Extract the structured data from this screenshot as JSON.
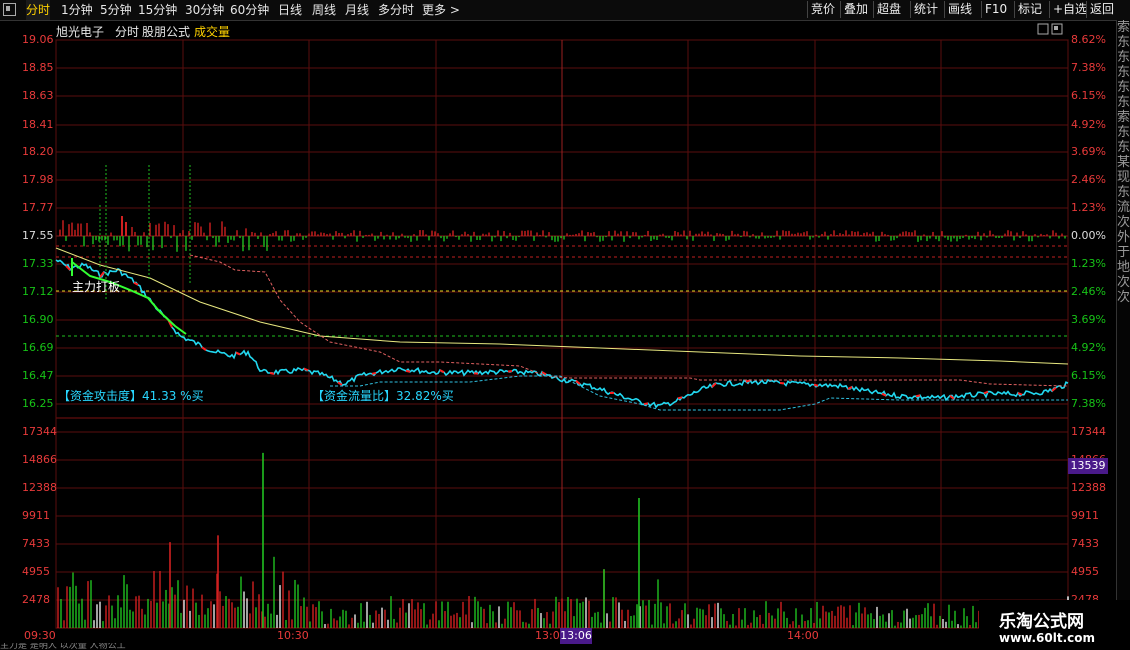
{
  "toolbar": {
    "tabs": [
      "分时",
      "1分钟",
      "5分钟",
      "15分钟",
      "30分钟",
      "60分钟",
      "日线",
      "周线",
      "月线",
      "多分时",
      "更多 >"
    ],
    "active": "分时",
    "right_buttons": [
      "竞价",
      "叠加",
      "超盘",
      "统计",
      "画线",
      "F10",
      "标记",
      "+自选",
      "返回"
    ]
  },
  "header": {
    "stock_name": "旭光电子",
    "mode": "分时",
    "formula": "股朋公式",
    "indicator": "成交量"
  },
  "annotations": {
    "main_force": "主力打板",
    "attack_label": "【资金攻击度】41.33 %买",
    "flow_label": "【资金流量比】32.82%买"
  },
  "price_axis": {
    "left": [
      "19.06",
      "18.85",
      "18.63",
      "18.41",
      "18.20",
      "17.98",
      "17.77",
      "17.55",
      "17.33",
      "17.12",
      "16.90",
      "16.69",
      "16.47",
      "16.25"
    ],
    "right": [
      "8.62%",
      "7.38%",
      "6.15%",
      "4.92%",
      "3.69%",
      "2.46%",
      "1.23%",
      "0.00%",
      "1.23%",
      "2.46%",
      "3.69%",
      "4.92%",
      "6.15%",
      "7.38%"
    ]
  },
  "volume_axis": {
    "left": [
      "17344",
      "14866",
      "12388",
      "9911",
      "7433",
      "4955",
      "2478"
    ],
    "right": [
      "17344",
      "14866",
      "12388",
      "9911",
      "7433",
      "4955",
      "2478"
    ]
  },
  "volume_badge": "13539",
  "time_axis": [
    "09:30",
    "10:30",
    "13:0",
    "14:00"
  ],
  "crosshair_time": "13:06",
  "side_text": "索东东东东东索东东某现东流次外于地次次",
  "watermark": {
    "title": "乐淘公式网",
    "url": "www.60lt.com"
  },
  "bottom_text": "主力是 是明人 以次量 人物公工"
}
